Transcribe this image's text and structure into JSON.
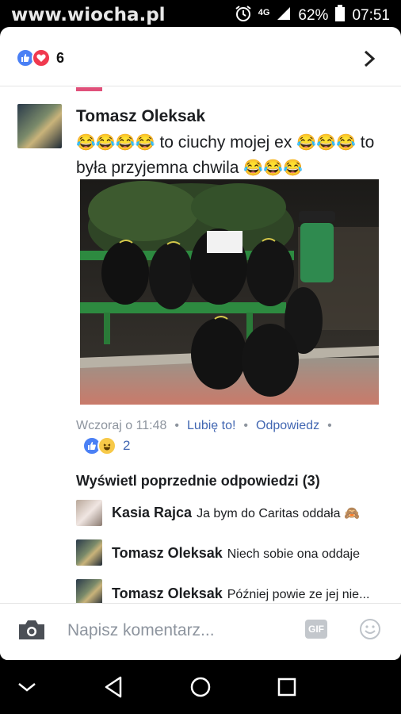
{
  "status_bar": {
    "watermark": "www.wiocha.pl",
    "network": "4G",
    "battery": "62%",
    "time": "07:51"
  },
  "reactions_header": {
    "count": "6",
    "icons": [
      "like-icon",
      "love-icon"
    ]
  },
  "post": {
    "author": "Tomasz Oleksak",
    "message_parts": [
      "😂😂😂😂",
      " to ciuchy mojej ex ",
      "😂😂😂",
      " to była przyjemna chwila ",
      "😂😂😂"
    ],
    "time": "Wczoraj o 11:48",
    "like_action": "Lubię to!",
    "reply_action": "Odpowiedz",
    "reaction_count": "2"
  },
  "replies": {
    "show_previous": "Wyświetl poprzednie odpowiedzi (3)",
    "items": [
      {
        "author": "Kasia Rajca",
        "text": "Ja bym do Caritas oddała 🙈"
      },
      {
        "author": "Tomasz Oleksak",
        "text": "Niech sobie ona oddaje"
      },
      {
        "author": "Tomasz Oleksak",
        "text": "Później powie ze jej nie..."
      }
    ]
  },
  "composer": {
    "placeholder": "Napisz komentarz...",
    "gif_label": "GIF"
  },
  "colors": {
    "accent": "#4267b2",
    "like": "#4a80f5",
    "love": "#f0394f",
    "muted": "#8d949e"
  }
}
